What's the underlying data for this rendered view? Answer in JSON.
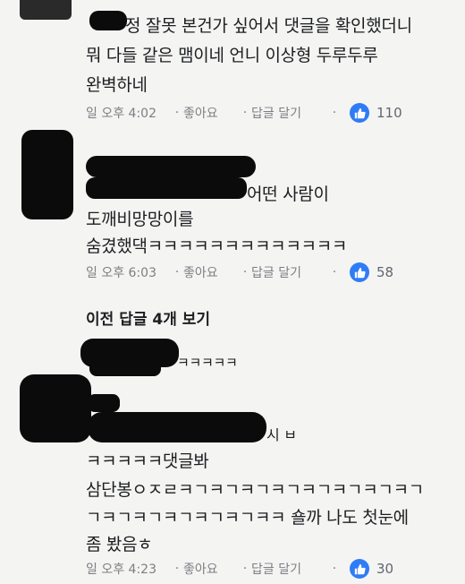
{
  "comments": [
    {
      "lines": [
        "정 잘못 본건가 싶어서 댓글을 확인했더니",
        "뭐 다들 같은 맴이네 언니 이상형 두루두루",
        "완벽하네"
      ],
      "time": "일 오후 4:02",
      "like_label": "좋아요",
      "reply_label": "답글 달기",
      "like_count": "110"
    },
    {
      "lines": [
        "어떤 사람이",
        "도깨비망망이를",
        "숨겼했댁ㅋㅋㅋㅋㅋㅋㅋㅋㅋㅋㅋㅋㅋ"
      ],
      "time": "일 오후 6:03",
      "like_label": "좋아요",
      "reply_label": "답글 달기",
      "like_count": "58"
    },
    {
      "lines": [
        "ㅋㅋㅋㅋㅋ",
        "시 ㅂ",
        "ㅋㅋㅋㅋㅋ댓글봐",
        "삼단봉ㅇㅈㄹㅋㄱㅋㄱㅋㄱㅋㄱㅋㄱㅋㄱㅋㄱㅋㄱ",
        "ㄱㅋㄱㅋㄱㅋㄱㅋㄱㅋㄱㅋㅋ 숄까 나도 첫눈에",
        "좀 봤음ㅎ"
      ],
      "time": "일 오후 4:23",
      "like_label": "좋아요",
      "reply_label": "답글 달기",
      "like_count": "30"
    }
  ],
  "view_previous": "이전 답글 4개 보기",
  "colors": {
    "like_blue": "#2f7cf6",
    "meta_gray": "#7c7f84",
    "text": "#1c1e21"
  },
  "icons": [
    "thumbs-up-icon"
  ]
}
